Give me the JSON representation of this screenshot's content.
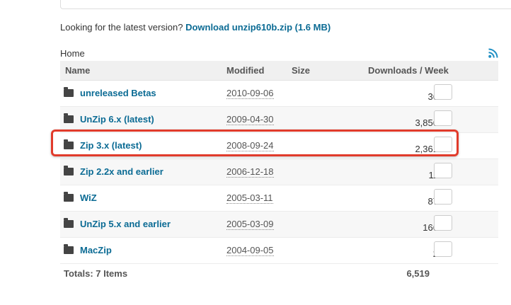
{
  "latest": {
    "prefix": "Looking for the latest version?",
    "link_label": "Download unzip610b.zip (1.6 MB)"
  },
  "breadcrumb": "Home",
  "table": {
    "headers": [
      "Name",
      "Modified",
      "Size",
      "Downloads / Week"
    ],
    "rows": [
      {
        "name": "unreleased Betas",
        "modified": "2010-09-06",
        "size": "",
        "downloads": "36"
      },
      {
        "name": "UnZip 6.x (latest)",
        "modified": "2009-04-30",
        "size": "",
        "downloads": "3,856"
      },
      {
        "name": "Zip 3.x (latest)",
        "modified": "2008-09-24",
        "size": "",
        "downloads": "2,361"
      },
      {
        "name": "Zip 2.2x and earlier",
        "modified": "2006-12-18",
        "size": "",
        "downloads": "11"
      },
      {
        "name": "WiZ",
        "modified": "2005-03-11",
        "size": "",
        "downloads": "87"
      },
      {
        "name": "UnZip 5.x and earlier",
        "modified": "2005-03-09",
        "size": "",
        "downloads": "166"
      },
      {
        "name": "MacZip",
        "modified": "2004-09-05",
        "size": "",
        "downloads": "2"
      }
    ],
    "totals_label": "Totals: 7 Items",
    "totals_downloads": "6,519"
  },
  "colors": {
    "link": "#0b6b94",
    "highlight": "#e13b2b",
    "rss": "#1f8fc4"
  },
  "icons": {
    "row": "folder-icon",
    "feed": "rss-icon"
  }
}
